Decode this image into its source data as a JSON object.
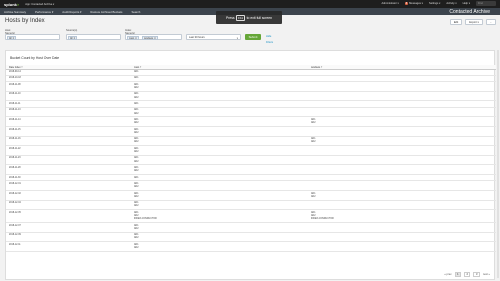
{
  "topbar": {
    "logo_main": "splunk",
    "logo_suffix": ">",
    "app_menu": "App: Contacted Archive ▾",
    "admin": "Administrator ▾",
    "messages_count": "8",
    "messages": "Messages ▾",
    "settings": "Settings ▾",
    "activity": "Activity ▾",
    "help": "Help ▾",
    "find_placeholder": "Find"
  },
  "nav": {
    "items": [
      "Archive Summary",
      "Performance ▾",
      "Audit Reports ▾",
      "Restore Archived Buckets",
      "Search"
    ],
    "app_title": "Contacted Archive"
  },
  "fullscreen": {
    "before": "Press",
    "key": "F11",
    "after": "to exit full screen"
  },
  "page": {
    "title": "Hosts by Index",
    "edit": "Edit",
    "export": "Export ▾",
    "more": "..."
  },
  "filters": {
    "host_label": "Host Name(s)",
    "host_token": "All ✕",
    "source_label": "Source(s)",
    "source_token": "All ✕",
    "index_label": "Index Name(s)",
    "index_tokens": [
      "main ✕",
      "windows ✕"
    ],
    "time_value": "Last 30 hours",
    "submit": "Submit",
    "hide_filters": "Hide Filters"
  },
  "panel": {
    "title": "Bucket Count by Host Over Date",
    "columns": [
      "Date Index ˅",
      "main ˅",
      "windows ˅"
    ],
    "rows": [
      {
        "date": "2018-09-14",
        "main": [
          "AD1"
        ],
        "windows": []
      },
      {
        "date": "2018-10-18",
        "main": [
          "AD1"
        ],
        "windows": []
      },
      {
        "date": "2018-11-08",
        "main": [
          "AD1",
          "AD2"
        ],
        "windows": []
      },
      {
        "date": "2018-11-10",
        "main": [
          "AD1",
          "AD2"
        ],
        "windows": []
      },
      {
        "date": "2018-11-11",
        "main": [
          "AD1"
        ],
        "windows": []
      },
      {
        "date": "2018-11-13",
        "main": [
          "AD1",
          "AD2"
        ],
        "windows": []
      },
      {
        "date": "2018-11-14",
        "main": [
          "AD1",
          "AD2"
        ],
        "windows": [
          "AD1",
          "AD2"
        ]
      },
      {
        "date": "2018-11-15",
        "main": [
          "AD1",
          "AD2"
        ],
        "windows": []
      },
      {
        "date": "2018-11-16",
        "main": [
          "AD1",
          "AD2"
        ],
        "windows": [
          "AD1",
          "AD2"
        ]
      },
      {
        "date": "2018-11-22",
        "main": [
          "AD1",
          "AD2"
        ],
        "windows": []
      },
      {
        "date": "2018-11-23",
        "main": [
          "AD1",
          "AD2"
        ],
        "windows": []
      },
      {
        "date": "2018-11-28",
        "main": [
          "AD1",
          "AD2"
        ],
        "windows": []
      },
      {
        "date": "2018-11-30",
        "main": [
          "AD1"
        ],
        "windows": []
      },
      {
        "date": "2018-12-01",
        "main": [
          "AD1",
          "AD2"
        ],
        "windows": []
      },
      {
        "date": "2018-12-02",
        "main": [
          "AD1",
          "AD2"
        ],
        "windows": [
          "AD1",
          "AD2"
        ]
      },
      {
        "date": "2018-12-04",
        "main": [
          "AD1",
          "AD2"
        ],
        "windows": []
      },
      {
        "date": "2018-12-05",
        "main": [
          "AD1",
          "AD2",
          "INDEX-CONDUCTOR"
        ],
        "windows": [
          "AD1",
          "AD2",
          "INDEX-CONDUCTOR"
        ]
      },
      {
        "date": "2018-12-07",
        "main": [
          "AD1",
          "AD2"
        ],
        "windows": []
      },
      {
        "date": "2018-12-09",
        "main": [
          "AD1",
          "AD2"
        ],
        "windows": []
      },
      {
        "date": "2018-12-11",
        "main": [
          "AD1",
          "AD2"
        ],
        "windows": []
      }
    ]
  },
  "pager": {
    "prev": "« prev",
    "pages": [
      "1",
      "2",
      "3"
    ],
    "next": "next »"
  }
}
